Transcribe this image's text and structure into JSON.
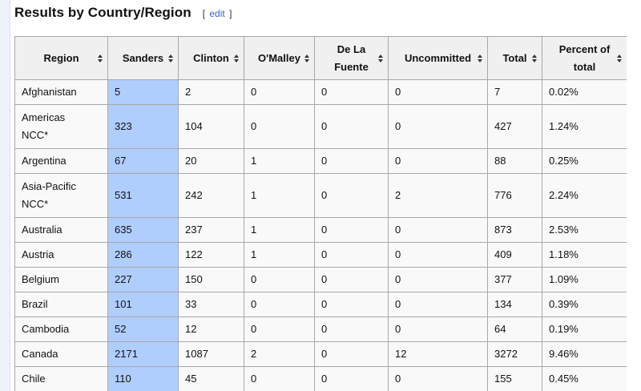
{
  "section": {
    "heading": "Results by Country/Region",
    "edit_open": "[",
    "edit_label": "edit",
    "edit_close": "]"
  },
  "colors": {
    "header_bg": "#f0f0f0",
    "cell_bg": "#f9f9f9",
    "winner_highlight": "#b0cefd",
    "link": "#3366cc",
    "border": "#a8a8a8"
  },
  "table": {
    "columns": [
      {
        "lines": [
          "Region"
        ]
      },
      {
        "lines": [
          "Sanders"
        ]
      },
      {
        "lines": [
          "Clinton"
        ]
      },
      {
        "lines": [
          "O'Malley"
        ]
      },
      {
        "lines": [
          "De La",
          "Fuente"
        ]
      },
      {
        "lines": [
          "Uncommitted"
        ]
      },
      {
        "lines": [
          "Total"
        ]
      },
      {
        "lines": [
          "Percent of",
          "total"
        ]
      }
    ],
    "sort_icon": "sort-arrows-icon",
    "rows": [
      {
        "region": [
          "Afghanistan"
        ],
        "cells": [
          "5",
          "2",
          "0",
          "0",
          "0",
          "7",
          "0.02%"
        ]
      },
      {
        "region": [
          "Americas",
          "NCC*"
        ],
        "cells": [
          "323",
          "104",
          "0",
          "0",
          "0",
          "427",
          "1.24%"
        ]
      },
      {
        "region": [
          "Argentina"
        ],
        "cells": [
          "67",
          "20",
          "1",
          "0",
          "0",
          "88",
          "0.25%"
        ]
      },
      {
        "region": [
          "Asia-Pacific",
          "NCC*"
        ],
        "cells": [
          "531",
          "242",
          "1",
          "0",
          "2",
          "776",
          "2.24%"
        ]
      },
      {
        "region": [
          "Australia"
        ],
        "cells": [
          "635",
          "237",
          "1",
          "0",
          "0",
          "873",
          "2.53%"
        ]
      },
      {
        "region": [
          "Austria"
        ],
        "cells": [
          "286",
          "122",
          "1",
          "0",
          "0",
          "409",
          "1.18%"
        ]
      },
      {
        "region": [
          "Belgium"
        ],
        "cells": [
          "227",
          "150",
          "0",
          "0",
          "0",
          "377",
          "1.09%"
        ]
      },
      {
        "region": [
          "Brazil"
        ],
        "cells": [
          "101",
          "33",
          "0",
          "0",
          "0",
          "134",
          "0.39%"
        ]
      },
      {
        "region": [
          "Cambodia"
        ],
        "cells": [
          "52",
          "12",
          "0",
          "0",
          "0",
          "64",
          "0.19%"
        ]
      },
      {
        "region": [
          "Canada"
        ],
        "cells": [
          "2171",
          "1087",
          "2",
          "0",
          "12",
          "3272",
          "9.46%"
        ]
      },
      {
        "region": [
          "Chile"
        ],
        "cells": [
          "110",
          "45",
          "0",
          "0",
          "0",
          "155",
          "0.45%"
        ]
      }
    ]
  }
}
